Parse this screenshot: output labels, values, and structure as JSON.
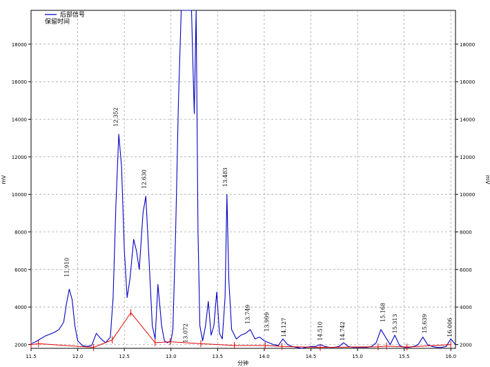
{
  "chart_data": {
    "type": "line",
    "xlabel": "分钟",
    "ylabel": "mV",
    "y2label": "mV",
    "xlim": [
      11.5,
      16.05
    ],
    "ylim": [
      1800,
      19800
    ],
    "xticks": [
      11.5,
      12.0,
      12.5,
      13.0,
      13.5,
      14.0,
      14.5,
      15.0,
      15.5,
      16.0
    ],
    "xtick_labels": [
      "11.5",
      "12.0",
      "12.5",
      "13.0",
      "13.5",
      "14.0",
      "14.5",
      "15.0",
      "15.5",
      "16.0"
    ],
    "yticks": [
      2000,
      4000,
      6000,
      8000,
      10000,
      12000,
      14000,
      16000,
      18000
    ],
    "ytick_labels": [
      "2000",
      "4000",
      "6000",
      "8000",
      "10000",
      "12000",
      "14000",
      "16000",
      "18000"
    ],
    "grid": true,
    "legend_position": "top-left",
    "legend": [
      "后部信号",
      "保留时间"
    ],
    "colors": {
      "signal": "#0000c0",
      "baseline": "#e00000",
      "grid": "#9a9a9a"
    },
    "series": [
      {
        "name": "后部信号",
        "x": [
          11.5,
          11.55,
          11.6,
          11.65,
          11.7,
          11.75,
          11.8,
          11.85,
          11.88,
          11.91,
          11.94,
          11.97,
          12.0,
          12.05,
          12.1,
          12.15,
          12.2,
          12.25,
          12.3,
          12.35,
          12.38,
          12.41,
          12.44,
          12.47,
          12.5,
          12.53,
          12.56,
          12.6,
          12.63,
          12.66,
          12.7,
          12.73,
          12.76,
          12.8,
          12.83,
          12.86,
          12.9,
          12.93,
          12.96,
          13.0,
          13.02,
          13.05,
          13.08,
          13.11,
          13.14,
          13.17,
          13.2,
          13.22,
          13.24,
          13.25,
          13.27,
          13.29,
          13.31,
          13.34,
          13.37,
          13.4,
          13.43,
          13.46,
          13.49,
          13.52,
          13.55,
          13.58,
          13.6,
          13.62,
          13.65,
          13.7,
          13.75,
          13.8,
          13.85,
          13.9,
          13.95,
          14.0,
          14.05,
          14.1,
          14.15,
          14.2,
          14.25,
          14.3,
          14.35,
          14.4,
          14.45,
          14.5,
          14.55,
          14.6,
          14.65,
          14.7,
          14.75,
          14.8,
          14.85,
          14.9,
          14.95,
          15.0,
          15.05,
          15.1,
          15.15,
          15.2,
          15.25,
          15.3,
          15.35,
          15.4,
          15.45,
          15.5,
          15.55,
          15.6,
          15.65,
          15.7,
          15.75,
          15.8,
          15.85,
          15.9,
          15.95,
          16.0,
          16.05
        ],
        "y": [
          2050,
          2150,
          2300,
          2450,
          2550,
          2650,
          2800,
          3200,
          4200,
          4950,
          4400,
          3000,
          2200,
          1950,
          1900,
          1950,
          2600,
          2300,
          2100,
          2400,
          4500,
          9500,
          13200,
          11500,
          7000,
          4500,
          5500,
          7600,
          7000,
          6000,
          9000,
          9900,
          7000,
          3000,
          2300,
          5200,
          3000,
          2200,
          2100,
          2200,
          2800,
          8000,
          15000,
          19800,
          19800,
          19800,
          19800,
          19800,
          16000,
          14300,
          19800,
          8000,
          3000,
          2200,
          3000,
          4300,
          2500,
          3000,
          4800,
          2600,
          2300,
          4500,
          10000,
          5500,
          2800,
          2300,
          2500,
          2600,
          2800,
          2300,
          2400,
          2200,
          2100,
          2000,
          1950,
          2300,
          2000,
          1900,
          1850,
          1800,
          1850,
          1900,
          1900,
          2000,
          1900,
          1850,
          1850,
          1900,
          2100,
          1900,
          1850,
          1850,
          1850,
          1850,
          1900,
          2100,
          2800,
          2400,
          2000,
          2500,
          1950,
          1850,
          1850,
          1900,
          2000,
          2400,
          2000,
          1900,
          1850,
          1850,
          1900,
          2300,
          2000
        ]
      },
      {
        "name": "baseline",
        "x": [
          11.5,
          11.58,
          12.17,
          12.37,
          12.57,
          12.83,
          12.99,
          13.32,
          13.68,
          14.01,
          14.19,
          14.6,
          15.22,
          15.31,
          15.53,
          16.0
        ],
        "y": [
          2000,
          2050,
          1850,
          2250,
          3700,
          2100,
          2150,
          2050,
          1950,
          1950,
          1900,
          1850,
          1880,
          1920,
          1870,
          2000
        ]
      }
    ],
    "annotations": [
      {
        "label": "11.910",
        "x": 11.905,
        "y": 5600
      },
      {
        "label": "12.352",
        "x": 12.43,
        "y": 13600
      },
      {
        "label": "12.630",
        "x": 12.73,
        "y": 10300
      },
      {
        "label": "13.072",
        "x": 13.175,
        "y": 2100
      },
      {
        "label": "13.483",
        "x": 13.6,
        "y": 10400
      },
      {
        "label": "13.749",
        "x": 13.84,
        "y": 3100
      },
      {
        "label": "13.999",
        "x": 14.05,
        "y": 2700
      },
      {
        "label": "14.127",
        "x": 14.23,
        "y": 2400
      },
      {
        "label": "14.510",
        "x": 14.62,
        "y": 2200
      },
      {
        "label": "14.742",
        "x": 14.86,
        "y": 2200
      },
      {
        "label": "15.168",
        "x": 15.29,
        "y": 3200
      },
      {
        "label": "15.313",
        "x": 15.42,
        "y": 2600
      },
      {
        "label": "15.639",
        "x": 15.74,
        "y": 2600
      },
      {
        "label": "16.006",
        "x": 16.01,
        "y": 2400
      }
    ]
  }
}
